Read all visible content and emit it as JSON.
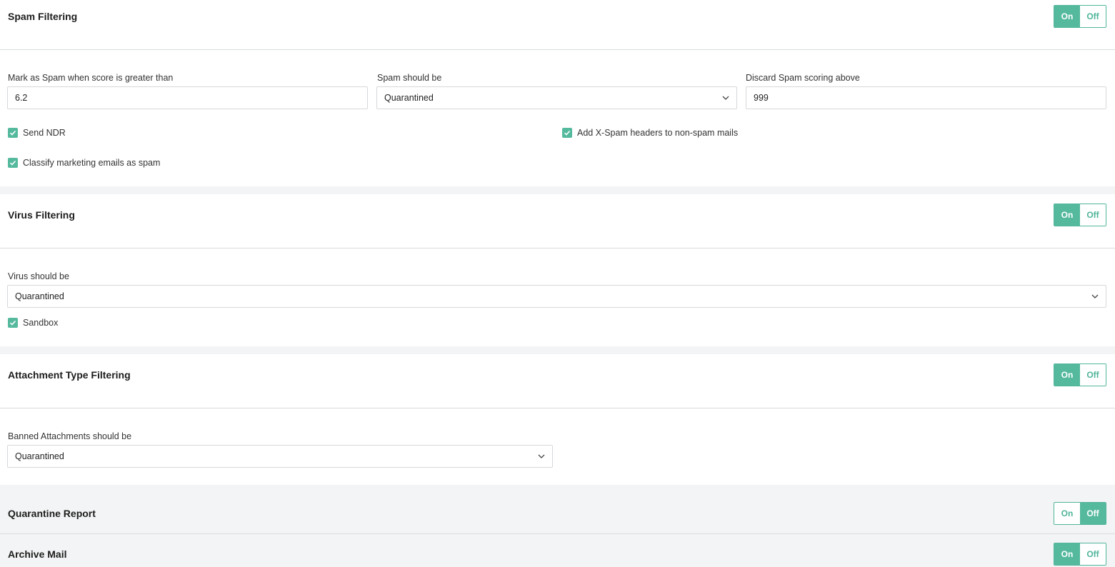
{
  "spam": {
    "title": "Spam Filtering",
    "toggle": {
      "on": "On",
      "off": "Off",
      "state": "on"
    },
    "score_label": "Mark as Spam when score is greater than",
    "score_value": "6.2",
    "action_label": "Spam should be",
    "action_value": "Quarantined",
    "discard_label": "Discard Spam scoring above",
    "discard_value": "999",
    "send_ndr": "Send NDR",
    "xspam_headers": "Add X-Spam headers to non-spam mails",
    "classify_marketing": "Classify marketing emails as spam"
  },
  "virus": {
    "title": "Virus Filtering",
    "toggle": {
      "on": "On",
      "off": "Off",
      "state": "on"
    },
    "action_label": "Virus should be",
    "action_value": "Quarantined",
    "sandbox": "Sandbox"
  },
  "attachment": {
    "title": "Attachment Type Filtering",
    "toggle": {
      "on": "On",
      "off": "Off",
      "state": "on"
    },
    "action_label": "Banned Attachments should be",
    "action_value": "Quarantined"
  },
  "quarantine_report": {
    "title": "Quarantine Report",
    "toggle": {
      "on": "On",
      "off": "Off",
      "state": "off"
    }
  },
  "archive_mail": {
    "title": "Archive Mail",
    "toggle": {
      "on": "On",
      "off": "Off",
      "state": "on"
    }
  },
  "colors": {
    "accent": "#55b99e",
    "border": "#d6d8db",
    "section_bg": "#f3f4f5"
  }
}
